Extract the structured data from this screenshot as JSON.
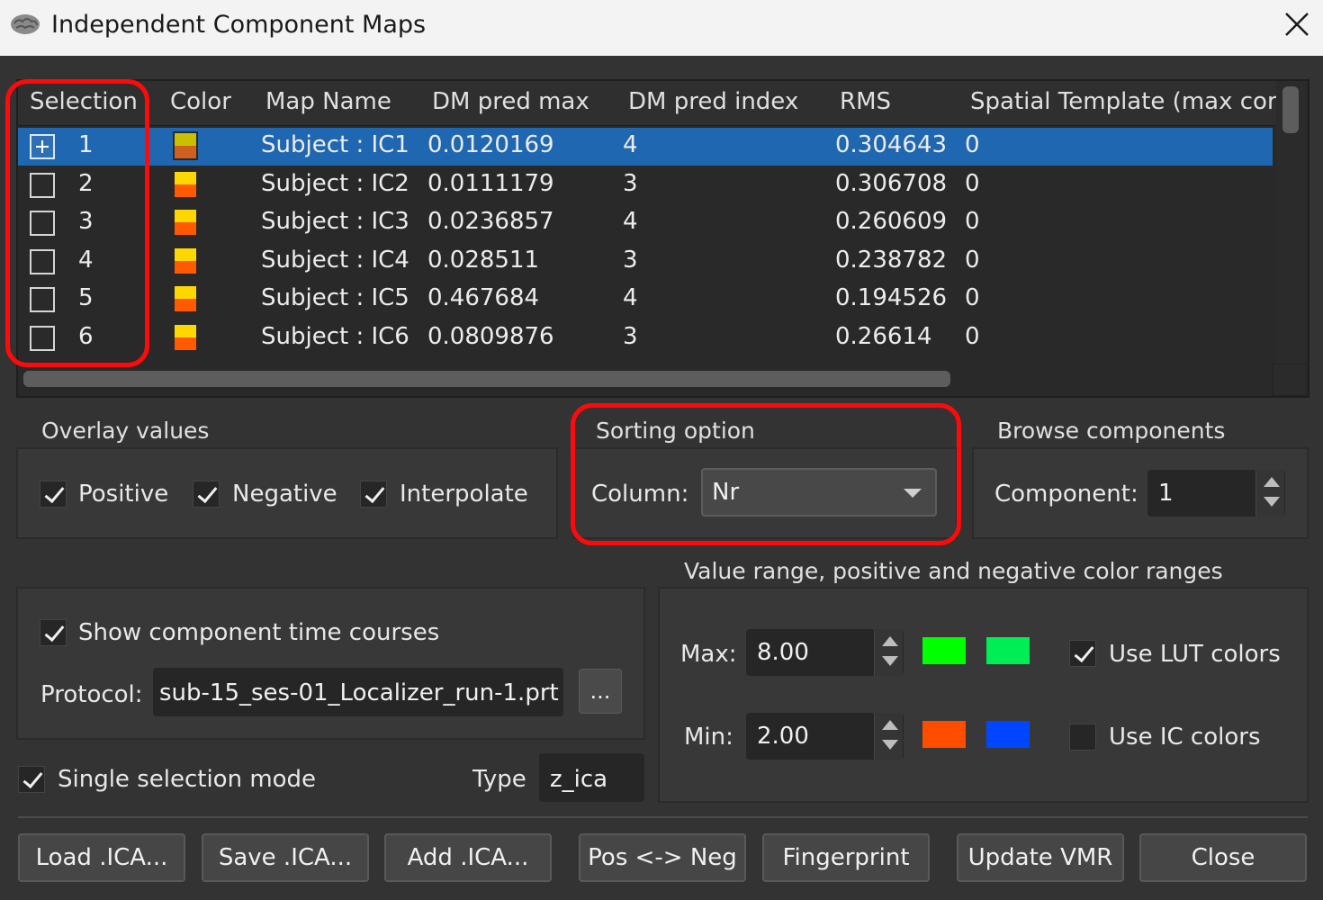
{
  "window": {
    "title": "Independent Component Maps"
  },
  "table": {
    "headers": [
      "Selection",
      "Color",
      "Map Name",
      "DM pred max",
      "DM pred index",
      "RMS",
      "Spatial Template (max corr)"
    ],
    "rows": [
      {
        "nr": "1",
        "name": "Subject : IC1",
        "dm_max": "0.0120169",
        "dm_index": "4",
        "rms": "0.304643",
        "template": "0"
      },
      {
        "nr": "2",
        "name": "Subject : IC2",
        "dm_max": "0.0111179",
        "dm_index": "3",
        "rms": "0.306708",
        "template": "0"
      },
      {
        "nr": "3",
        "name": "Subject : IC3",
        "dm_max": "0.0236857",
        "dm_index": "4",
        "rms": "0.260609",
        "template": "0"
      },
      {
        "nr": "4",
        "name": "Subject : IC4",
        "dm_max": "0.028511",
        "dm_index": "3",
        "rms": "0.238782",
        "template": "0"
      },
      {
        "nr": "5",
        "name": "Subject : IC5",
        "dm_max": "0.467684",
        "dm_index": "4",
        "rms": "0.194526",
        "template": "0"
      },
      {
        "nr": "6",
        "name": "Subject : IC6",
        "dm_max": "0.0809876",
        "dm_index": "3",
        "rms": "0.26614",
        "template": "0"
      }
    ],
    "swatch_colors": {
      "top": "#ffd700",
      "bottom": "#ff5a00",
      "selected_top": "#c8c000",
      "selected_bottom": "#d06020"
    }
  },
  "overlay": {
    "title": "Overlay values",
    "positive": "Positive",
    "negative": "Negative",
    "interpolate": "Interpolate"
  },
  "sorting": {
    "title": "Sorting option",
    "column_label": "Column:",
    "column_value": "Nr"
  },
  "browse": {
    "title": "Browse components",
    "component_label": "Component:",
    "component_value": "1"
  },
  "timecourse": {
    "show_label": "Show component time courses",
    "protocol_label": "Protocol:",
    "protocol_value": "sub-15_ses-01_Localizer_run-1.prt",
    "browse_button": "..."
  },
  "selection_mode": {
    "single_label": "Single selection mode",
    "type_label": "Type",
    "type_value": "z_ica"
  },
  "range": {
    "title": "Value range, positive and negative color ranges",
    "max_label": "Max:",
    "max_value": "8.00",
    "min_label": "Min:",
    "min_value": "2.00",
    "use_lut": "Use LUT colors",
    "use_ic": "Use IC colors",
    "colors": {
      "pos_max": "#00ff00",
      "pos_min": "#00ee55",
      "neg_max": "#ff4d00",
      "neg_min": "#0046ff"
    }
  },
  "buttons": {
    "load": "Load .ICA...",
    "save": "Save .ICA...",
    "add": "Add .ICA...",
    "posneg": "Pos <-> Neg",
    "fingerprint": "Fingerprint",
    "update_vmr": "Update VMR",
    "close": "Close"
  }
}
